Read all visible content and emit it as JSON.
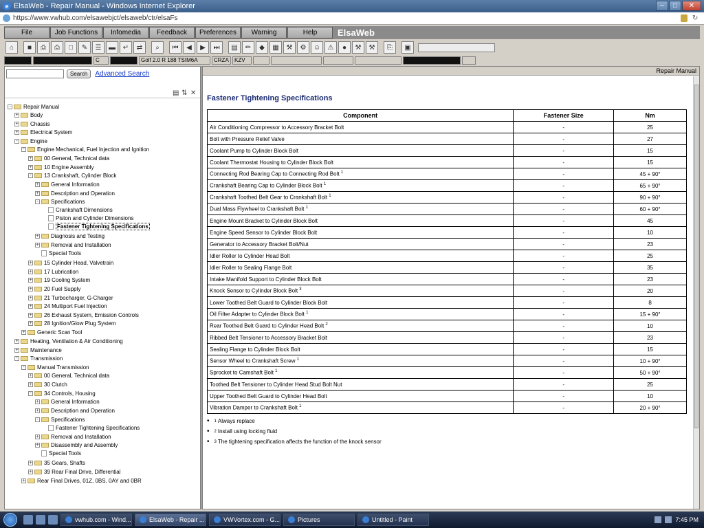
{
  "window": {
    "title": "ElsaWeb - Repair Manual - Windows Internet Explorer",
    "minimize": "–",
    "maximize": "□",
    "close": "✕"
  },
  "address": {
    "url": "https://www.vwhub.com/elsawebjct/elsaweb/ctr/elsaFs"
  },
  "menu": {
    "items": [
      "File",
      "Job Functions",
      "Infomedia",
      "Feedback",
      "Preferences",
      "Warning",
      "Help"
    ],
    "brand": "ElsaWeb"
  },
  "toolbar": {
    "icons": [
      "home-icon",
      "stop-icon",
      "print-icon",
      "printer-icon",
      "page-icon",
      "edit-icon",
      "note-icon",
      "car-icon",
      "return-icon",
      "swap-icon",
      "search-icon",
      "first-icon",
      "prev-icon",
      "next-icon",
      "last-icon",
      "book-icon",
      "pencil-icon",
      "diamond-icon",
      "grid-icon",
      "wrench-icon",
      "engine-icon",
      "person-icon",
      "warning-icon",
      "globe-icon",
      "tools-icon",
      "hammer-icon",
      "clipboard-icon",
      "window-icon"
    ]
  },
  "vehicle": {
    "fields": [
      "",
      "",
      "C",
      "",
      "Golf 2.0 R 188 TSIM6A",
      "CRZA",
      "KZV",
      "",
      "",
      "",
      "",
      "",
      ""
    ]
  },
  "search": {
    "placeholder": "",
    "button": "Search",
    "advanced": "Advanced Search"
  },
  "tree": [
    {
      "label": "Repair Manual",
      "level": 0,
      "type": "folder",
      "exp": "-"
    },
    {
      "label": "Body",
      "level": 1,
      "type": "folder",
      "exp": "+"
    },
    {
      "label": "Chassis",
      "level": 1,
      "type": "folder",
      "exp": "+"
    },
    {
      "label": "Electrical System",
      "level": 1,
      "type": "folder",
      "exp": "+"
    },
    {
      "label": "Engine",
      "level": 1,
      "type": "folder",
      "exp": "-"
    },
    {
      "label": "Engine Mechanical, Fuel Injection and Ignition",
      "level": 2,
      "type": "folder",
      "exp": "-"
    },
    {
      "label": "00 General, Technical data",
      "level": 3,
      "type": "folder",
      "exp": "+"
    },
    {
      "label": "10 Engine Assembly",
      "level": 3,
      "type": "folder",
      "exp": "+"
    },
    {
      "label": "13 Crankshaft, Cylinder Block",
      "level": 3,
      "type": "folder",
      "exp": "-"
    },
    {
      "label": "General Information",
      "level": 4,
      "type": "folder",
      "exp": "+"
    },
    {
      "label": "Description and Operation",
      "level": 4,
      "type": "folder",
      "exp": "+"
    },
    {
      "label": "Specifications",
      "level": 4,
      "type": "folder",
      "exp": "-"
    },
    {
      "label": "Crankshaft Dimensions",
      "level": 5,
      "type": "doc",
      "exp": ""
    },
    {
      "label": "Piston and Cylinder Dimensions",
      "level": 5,
      "type": "doc",
      "exp": ""
    },
    {
      "label": "Fastener Tightening Specifications",
      "level": 5,
      "type": "doc",
      "exp": "",
      "selected": true
    },
    {
      "label": "Diagnosis and Testing",
      "level": 4,
      "type": "folder",
      "exp": "+"
    },
    {
      "label": "Removal and Installation",
      "level": 4,
      "type": "folder",
      "exp": "+"
    },
    {
      "label": "Special Tools",
      "level": 4,
      "type": "doc",
      "exp": ""
    },
    {
      "label": "15 Cylinder Head, Valvetrain",
      "level": 3,
      "type": "folder",
      "exp": "+"
    },
    {
      "label": "17 Lubrication",
      "level": 3,
      "type": "folder",
      "exp": "+"
    },
    {
      "label": "19 Cooling System",
      "level": 3,
      "type": "folder",
      "exp": "+"
    },
    {
      "label": "20 Fuel Supply",
      "level": 3,
      "type": "folder",
      "exp": "+"
    },
    {
      "label": "21 Turbocharger, G-Charger",
      "level": 3,
      "type": "folder",
      "exp": "+"
    },
    {
      "label": "24 Multiport Fuel Injection",
      "level": 3,
      "type": "folder",
      "exp": "+"
    },
    {
      "label": "26 Exhaust System, Emission Controls",
      "level": 3,
      "type": "folder",
      "exp": "+"
    },
    {
      "label": "28 Ignition/Glow Plug System",
      "level": 3,
      "type": "folder",
      "exp": "+"
    },
    {
      "label": "Generic Scan Tool",
      "level": 2,
      "type": "folder",
      "exp": "+"
    },
    {
      "label": "Heating, Ventilation & Air Conditioning",
      "level": 1,
      "type": "folder",
      "exp": "+"
    },
    {
      "label": "Maintenance",
      "level": 1,
      "type": "folder",
      "exp": "+"
    },
    {
      "label": "Transmission",
      "level": 1,
      "type": "folder",
      "exp": "-"
    },
    {
      "label": "Manual Transmission",
      "level": 2,
      "type": "folder",
      "exp": "-"
    },
    {
      "label": "00 General, Technical data",
      "level": 3,
      "type": "folder",
      "exp": "+"
    },
    {
      "label": "30 Clutch",
      "level": 3,
      "type": "folder",
      "exp": "+"
    },
    {
      "label": "34 Controls, Housing",
      "level": 3,
      "type": "folder",
      "exp": "-"
    },
    {
      "label": "General Information",
      "level": 4,
      "type": "folder",
      "exp": "+"
    },
    {
      "label": "Description and Operation",
      "level": 4,
      "type": "folder",
      "exp": "+"
    },
    {
      "label": "Specifications",
      "level": 4,
      "type": "folder",
      "exp": "-"
    },
    {
      "label": "Fastener Tightening Specifications",
      "level": 5,
      "type": "doc",
      "exp": ""
    },
    {
      "label": "Removal and Installation",
      "level": 4,
      "type": "folder",
      "exp": "+"
    },
    {
      "label": "Disassembly and Assembly",
      "level": 4,
      "type": "folder",
      "exp": "+"
    },
    {
      "label": "Special Tools",
      "level": 4,
      "type": "doc",
      "exp": ""
    },
    {
      "label": "35 Gears, Shafts",
      "level": 3,
      "type": "folder",
      "exp": "+"
    },
    {
      "label": "39 Rear Final Drive, Differential",
      "level": 3,
      "type": "folder",
      "exp": "+"
    },
    {
      "label": "Rear Final Drives, 01Z, 0BS, 0AY and 0BR",
      "level": 2,
      "type": "folder",
      "exp": "+"
    }
  ],
  "document": {
    "header": "Repair Manual",
    "title": "Fastener Tightening Specifications",
    "columns": [
      "Component",
      "Fastener Size",
      "Nm"
    ],
    "rows": [
      {
        "component": "Air Conditioning Compressor to Accessory Bracket Bolt",
        "note": "",
        "size": "-",
        "nm": "25"
      },
      {
        "component": "Bolt with Pressure Relief Valve",
        "note": "",
        "size": "-",
        "nm": "27"
      },
      {
        "component": "Coolant Pump to Cylinder Block Bolt",
        "note": "",
        "size": "-",
        "nm": "15"
      },
      {
        "component": "Coolant Thermostat Housing to Cylinder Block Bolt",
        "note": "",
        "size": "-",
        "nm": "15"
      },
      {
        "component": "Connecting Rod Bearing Cap to Connecting Rod Bolt",
        "note": "1",
        "size": "-",
        "nm": "45 + 90°"
      },
      {
        "component": "Crankshaft Bearing Cap to Cylinder Block Bolt",
        "note": "1",
        "size": "-",
        "nm": "65 + 90°"
      },
      {
        "component": "Crankshaft Toothed Belt Gear to Crankshaft Bolt",
        "note": "1",
        "size": "-",
        "nm": "90 + 90°"
      },
      {
        "component": "Dual Mass Flywheel to Crankshaft Bolt",
        "note": "1",
        "size": "-",
        "nm": "60 + 90°"
      },
      {
        "component": "Engine Mount Bracket to Cylinder Block Bolt",
        "note": "",
        "size": "-",
        "nm": "45"
      },
      {
        "component": "Engine Speed Sensor to Cylinder Block Bolt",
        "note": "",
        "size": "-",
        "nm": "10"
      },
      {
        "component": "Generator to Accessory Bracket Bolt/Nut",
        "note": "",
        "size": "-",
        "nm": "23"
      },
      {
        "component": "Idler Roller to Cylinder Head Bolt",
        "note": "",
        "size": "-",
        "nm": "25"
      },
      {
        "component": "Idler Roller to Sealing Flange Bolt",
        "note": "",
        "size": "-",
        "nm": "35"
      },
      {
        "component": "Intake Manifold Support to Cylinder Block Bolt",
        "note": "",
        "size": "-",
        "nm": "23"
      },
      {
        "component": "Knock Sensor to Cylinder Block Bolt",
        "note": "3",
        "size": "-",
        "nm": "20"
      },
      {
        "component": "Lower Toothed Belt Guard to Cylinder Block Bolt",
        "note": "",
        "size": "-",
        "nm": "8"
      },
      {
        "component": "Oil Filter Adapter to Cylinder Block Bolt",
        "note": "1",
        "size": "-",
        "nm": "15 + 90°"
      },
      {
        "component": "Rear Toothed Belt Guard to Cylinder Head Bolt",
        "note": "2",
        "size": "-",
        "nm": "10"
      },
      {
        "component": "Ribbed Belt Tensioner to Accessory Bracket Bolt",
        "note": "",
        "size": "-",
        "nm": "23"
      },
      {
        "component": "Sealing Flange to Cylinder Block Bolt",
        "note": "",
        "size": "-",
        "nm": "15"
      },
      {
        "component": "Sensor Wheel to Crankshaft Screw",
        "note": "1",
        "size": "-",
        "nm": "10 + 90°"
      },
      {
        "component": "Sprocket to Camshaft Bolt",
        "note": "1",
        "size": "-",
        "nm": "50 + 90°"
      },
      {
        "component": "Toothed Belt Tensioner to Cylinder Head Stud Bolt Nut",
        "note": "",
        "size": "-",
        "nm": "25"
      },
      {
        "component": "Upper Toothed Belt Guard to Cylinder Head Bolt",
        "note": "",
        "size": "-",
        "nm": "10"
      },
      {
        "component": "Vibration Damper to Crankshaft Bolt",
        "note": "1",
        "size": "-",
        "nm": "20 + 90°"
      }
    ],
    "footnotes": [
      {
        "mark": "1",
        "text": "Always replace"
      },
      {
        "mark": "2",
        "text": "Install using locking fluid"
      },
      {
        "mark": "3",
        "text": "The tightening specification affects the function of the knock sensor"
      }
    ]
  },
  "taskbar": {
    "tasks": [
      {
        "label": "vwhub.com - Wind...",
        "active": false
      },
      {
        "label": "ElsaWeb - Repair ...",
        "active": true
      },
      {
        "label": "VWVortex.com - G...",
        "active": false
      },
      {
        "label": "Pictures",
        "active": false
      },
      {
        "label": "Untitled - Paint",
        "active": false
      }
    ],
    "clock": "7:45 PM"
  }
}
